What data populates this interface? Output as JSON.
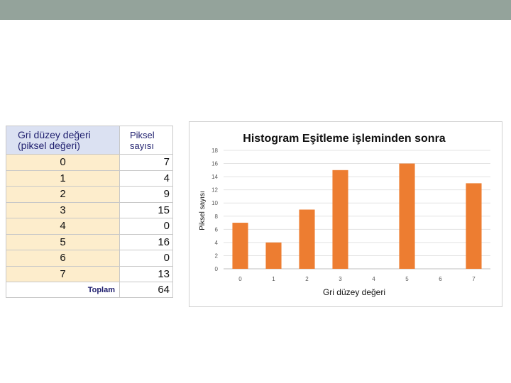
{
  "table": {
    "header_value": [
      "Gri düzey değeri",
      "(piksel değeri)"
    ],
    "header_count": [
      "Piksel",
      "sayısı"
    ],
    "rows": [
      {
        "value": "0",
        "count": "7"
      },
      {
        "value": "1",
        "count": "4"
      },
      {
        "value": "2",
        "count": "9"
      },
      {
        "value": "3",
        "count": "15"
      },
      {
        "value": "4",
        "count": "0"
      },
      {
        "value": "5",
        "count": "16"
      },
      {
        "value": "6",
        "count": "0"
      },
      {
        "value": "7",
        "count": "13"
      }
    ],
    "total_label": "Toplam",
    "total_value": "64"
  },
  "chart_data": {
    "type": "bar",
    "title": "Histogram Eşitleme işleminden sonra",
    "xlabel": "Gri düzey değeri",
    "ylabel": "Piksel sayısı",
    "categories": [
      "0",
      "1",
      "2",
      "3",
      "4",
      "5",
      "6",
      "7"
    ],
    "values": [
      7,
      4,
      9,
      15,
      0,
      16,
      0,
      13
    ],
    "ylim": [
      0,
      18
    ],
    "yticks": [
      0,
      2,
      4,
      6,
      8,
      10,
      12,
      14,
      16,
      18
    ],
    "grid": true,
    "bar_color": "#ed7d31"
  },
  "colors": {
    "top_bar": "#94a39b",
    "header_bg": "#dbe1f2",
    "value_cell_bg": "#fdedcc"
  }
}
